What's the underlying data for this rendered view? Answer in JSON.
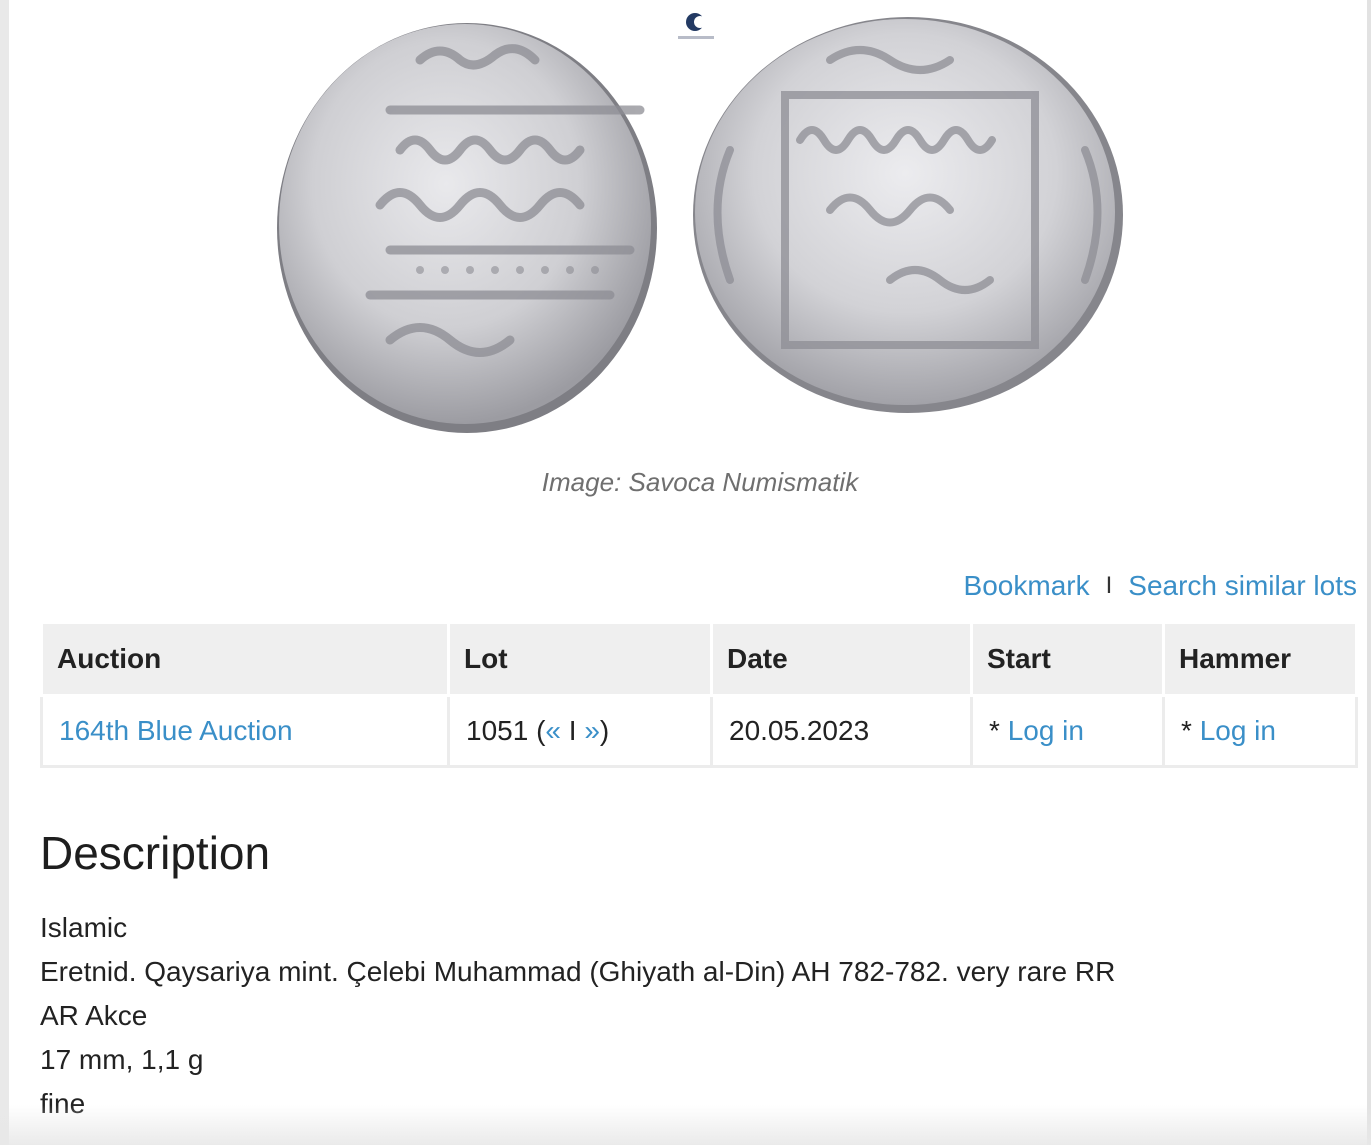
{
  "image": {
    "caption": "Image: Savoca Numismatik",
    "watermark_icon": "savoca-logo-icon"
  },
  "actions": {
    "bookmark": "Bookmark",
    "separator": "I",
    "search_similar": "Search similar lots"
  },
  "lot_table": {
    "headers": [
      "Auction",
      "Lot",
      "Date",
      "Start",
      "Hammer"
    ],
    "row": {
      "auction": "164th Blue Auction",
      "lot_number": "1051 (",
      "prev": "«",
      "lot_sep": " I ",
      "next": "»",
      "lot_close": ")",
      "date": "20.05.2023",
      "start_prefix": "* ",
      "start_link": "Log in",
      "hammer_prefix": "* ",
      "hammer_link": "Log in"
    }
  },
  "description": {
    "heading": "Description",
    "lines": [
      "Islamic",
      "Eretnid. Qaysariya mint. Çelebi Muhammad (Ghiyath al-Din) AH 782-782. very rare RR",
      "AR Akce",
      "17 mm, 1,1 g",
      "fine"
    ]
  },
  "colors": {
    "link": "#3a8fc8",
    "header_bg": "#efefef",
    "caption": "#6f6f6f"
  }
}
